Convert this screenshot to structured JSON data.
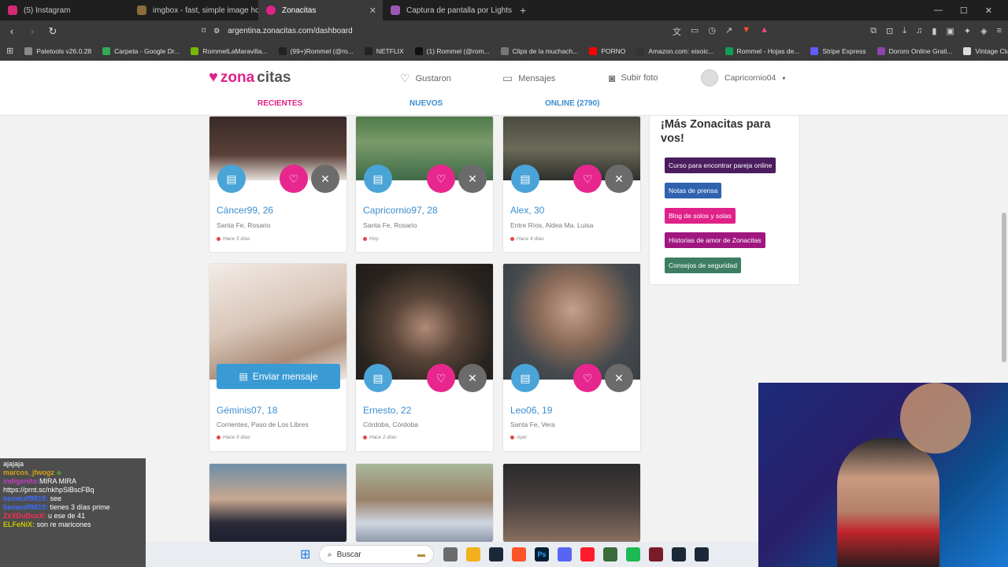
{
  "browser": {
    "tabs": [
      {
        "title": "(5) Instagram",
        "color": "#d62976"
      },
      {
        "title": "imgbox - fast, simple image host",
        "color": "#8a6d3b"
      },
      {
        "title": "Zonacitas",
        "color": "#e0218a",
        "active": true
      },
      {
        "title": "Captura de pantalla por Lightshot",
        "color": "#9b59b6"
      }
    ],
    "new_tab": "+",
    "win_min": "—",
    "win_max": "☐",
    "win_close": "✕",
    "url": "argentina.zonacitas.com/dashboard",
    "bookmarks": [
      {
        "label": "Paletools v26.0.28",
        "color": "#888888"
      },
      {
        "label": "Carpeta - Google Dr...",
        "color": "#34a853"
      },
      {
        "label": "RommelLaMaravilla...",
        "color": "#76b900"
      },
      {
        "label": "(99+)Rommel (@ro...",
        "color": "#222222"
      },
      {
        "label": "NETFLIX",
        "color": "#222222"
      },
      {
        "label": "(1) Rommel (@rom...",
        "color": "#111111"
      },
      {
        "label": "Clips de la muchach...",
        "color": "#777777"
      },
      {
        "label": "PORNO",
        "color": "#ff0000"
      },
      {
        "label": "Amazon.com: eisoic...",
        "color": "#333333"
      },
      {
        "label": "Rommel - Hojas de...",
        "color": "#0f9d58"
      },
      {
        "label": "Stripe Express",
        "color": "#635bff"
      },
      {
        "label": "Dororo Online Grati...",
        "color": "#8e44ad"
      },
      {
        "label": "Vintage Club UK - O...",
        "color": "#dddddd"
      }
    ]
  },
  "site": {
    "logo_zona": "zona",
    "logo_citas": "citas",
    "nav": {
      "likes": "Gustaron",
      "messages": "Mensajes",
      "upload": "Subir foto"
    },
    "username": "Capricornio04",
    "subtabs": {
      "recent": "RECIENTES",
      "new": "NUEVOS",
      "online": "ONLINE (2790)"
    }
  },
  "cards": [
    {
      "name": "Cáncer99, 26",
      "location": "Santa Fe, Rosario",
      "seen": "Hace 5 días"
    },
    {
      "name": "Capricornio97, 28",
      "location": "Santa Fe, Rosario",
      "seen": "Hoy"
    },
    {
      "name": "Alex, 30",
      "location": "Entre Ríos, Aldea Ma. Luisa",
      "seen": "Hace 4 días"
    },
    {
      "name": "Géminis07, 18",
      "location": "Corrientes, Paso de Los Libres",
      "seen": "Hace 5 días"
    },
    {
      "name": "Ernesto, 22",
      "location": "Córdoba, Córdoba",
      "seen": "Hace 2 días"
    },
    {
      "name": "Leo06, 19",
      "location": "Santa Fe, Vera",
      "seen": "Ayer"
    }
  ],
  "send_message_label": "Enviar mensaje",
  "sidebar": {
    "title": "¡Más Zonacitas para vos!",
    "links": [
      {
        "label": "Curso para encontrar pareja online",
        "color": "#4a1d5e"
      },
      {
        "label": "Notas de prensa",
        "color": "#2f63b0"
      },
      {
        "label": "Blog de solos y solas",
        "color": "#e0218a"
      },
      {
        "label": "Historias de amor de Zonacitas",
        "color": "#a0177f"
      },
      {
        "label": "Consejos de seguridad",
        "color": "#3d7e63"
      }
    ]
  },
  "chat": [
    {
      "user": "",
      "text": "ajajaja",
      "user_color": "#ffffff"
    },
    {
      "user": "marcos_jfwogz",
      "text": "",
      "user_color": "#d4a017"
    },
    {
      "user": "indigenito:",
      "text": "MIRA MIRA",
      "user_color": "#c040c0"
    },
    {
      "user": "",
      "text": "https://prnt.sc/nkhpSlBscFBq",
      "user_color": "#ffffff"
    },
    {
      "user": "beowulf9819:",
      "text": "see",
      "user_color": "#3c6cff"
    },
    {
      "user": "beowulf9819:",
      "text": "tienes 3 días prime",
      "user_color": "#3c6cff"
    },
    {
      "user": "ZxXDuDuxX:",
      "text": "u ese de 41",
      "user_color": "#ff2d55"
    },
    {
      "user": "ELFeNiX:",
      "text": "son re maricones",
      "user_color": "#c8c800"
    }
  ],
  "taskbar": {
    "search": "Buscar"
  }
}
